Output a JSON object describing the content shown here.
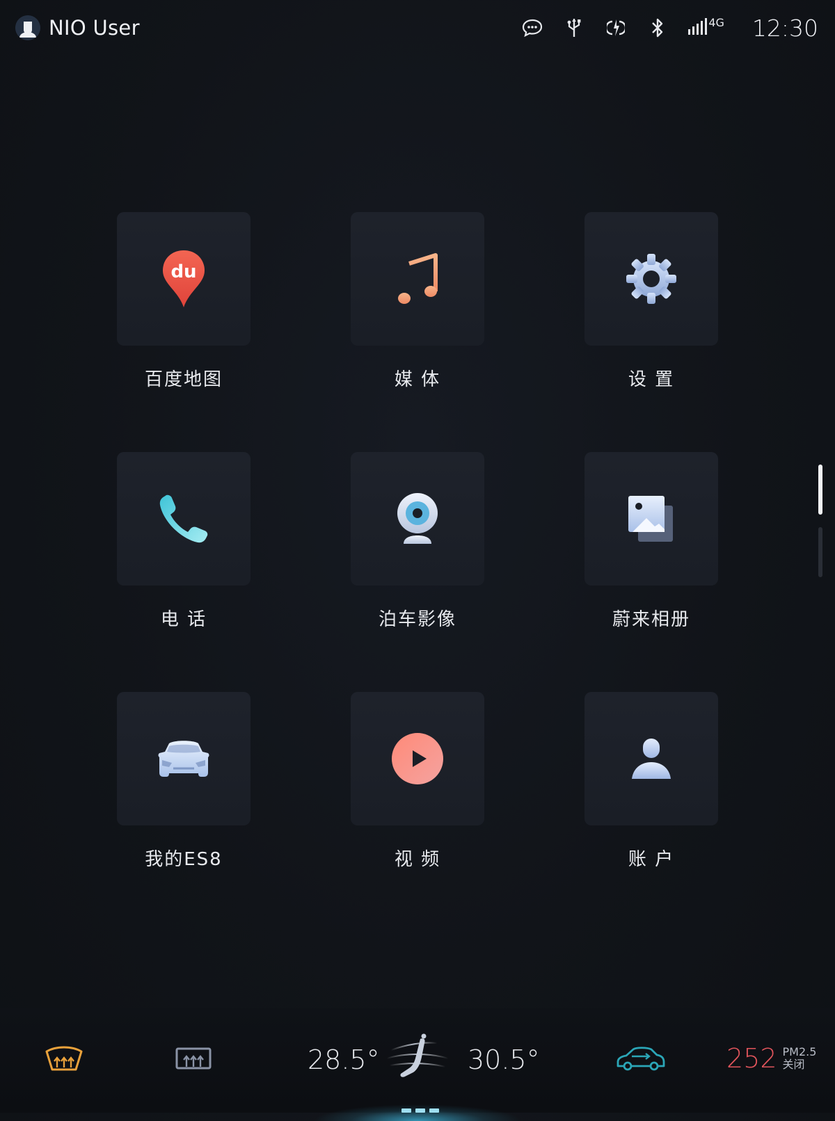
{
  "status_bar": {
    "user_name": "NIO User",
    "network_type": "4G",
    "time": "12:30",
    "icons": [
      "message-icon",
      "usb-icon",
      "wireless-charge-icon",
      "bluetooth-icon",
      "signal-icon"
    ]
  },
  "apps": [
    {
      "label": "百度地图",
      "icon": "baidu-map-icon",
      "badge_text": "du"
    },
    {
      "label": "媒 体",
      "icon": "music-note-icon"
    },
    {
      "label": "设 置",
      "icon": "gear-icon"
    },
    {
      "label": "电 话",
      "icon": "phone-icon"
    },
    {
      "label": "泊车影像",
      "icon": "camera-icon"
    },
    {
      "label": "蔚来相册",
      "icon": "photo-album-icon"
    },
    {
      "label": "我的ES8",
      "icon": "car-icon"
    },
    {
      "label": "视 频",
      "icon": "play-icon"
    },
    {
      "label": "账 户",
      "icon": "account-icon"
    }
  ],
  "page_indicator": {
    "pages": 2,
    "active": 0
  },
  "climate": {
    "left_temp": "28.5°",
    "right_temp": "30.5°",
    "aqi_value": "252",
    "aqi_label": "PM2.5",
    "purifier_status": "关闭"
  },
  "colors": {
    "accent_orange": "#e9a13b",
    "baidu_red": "#ee5448",
    "music_orange": "#f4a07a",
    "phone_cyan": "#5fd6e6",
    "aqi_red": "#e0545b",
    "car_teal": "#2ba6b7"
  }
}
